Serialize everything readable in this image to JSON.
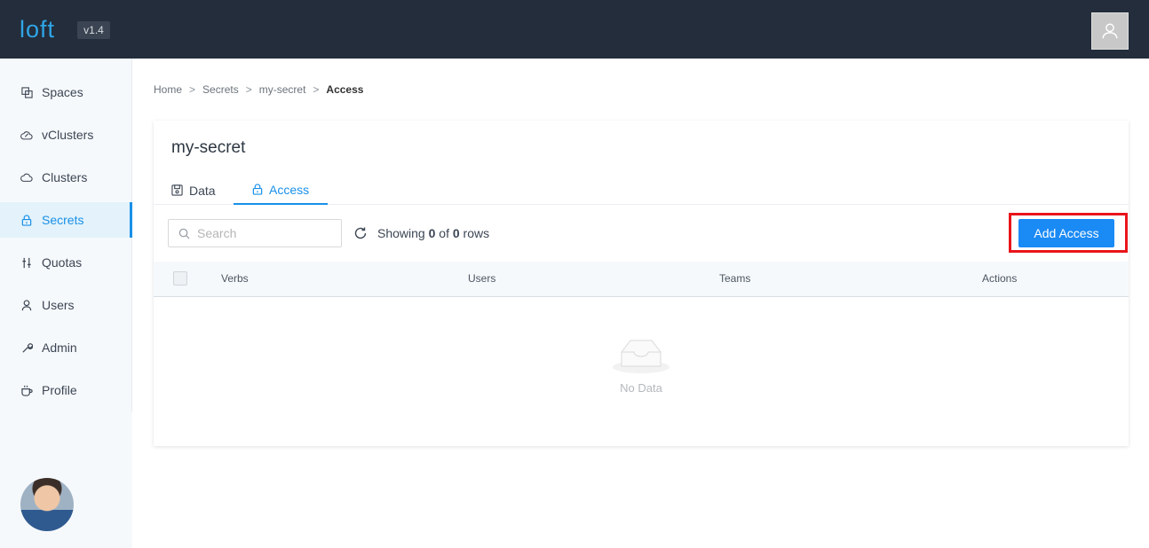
{
  "app": {
    "logo": "loft",
    "version": "v1.4"
  },
  "sidebar": {
    "items": [
      {
        "label": "Spaces",
        "icon": "spaces-icon"
      },
      {
        "label": "vClusters",
        "icon": "vclusters-icon"
      },
      {
        "label": "Clusters",
        "icon": "cloud-icon"
      },
      {
        "label": "Secrets",
        "icon": "lock-icon",
        "active": true
      },
      {
        "label": "Quotas",
        "icon": "sliders-icon"
      },
      {
        "label": "Users",
        "icon": "user-icon"
      },
      {
        "label": "Admin",
        "icon": "wrench-icon"
      },
      {
        "label": "Profile",
        "icon": "coffee-icon"
      }
    ]
  },
  "breadcrumb": [
    "Home",
    "Secrets",
    "my-secret",
    "Access"
  ],
  "breadcrumb_separator": ">",
  "page": {
    "title": "my-secret",
    "tabs": [
      {
        "label": "Data",
        "icon": "save-icon"
      },
      {
        "label": "Access",
        "icon": "lock-icon",
        "active": true
      }
    ]
  },
  "toolbar": {
    "search_placeholder": "Search",
    "showing_prefix": "Showing",
    "showing_shown": "0",
    "showing_of": "of",
    "showing_total": "0",
    "showing_suffix": "rows",
    "add_button": "Add Access"
  },
  "table": {
    "columns": [
      "Verbs",
      "Users",
      "Teams",
      "Actions"
    ],
    "rows": [],
    "empty_text": "No Data"
  },
  "colors": {
    "accent": "#1890e8",
    "topbar": "#232d3b",
    "highlight": "#e8151b"
  }
}
